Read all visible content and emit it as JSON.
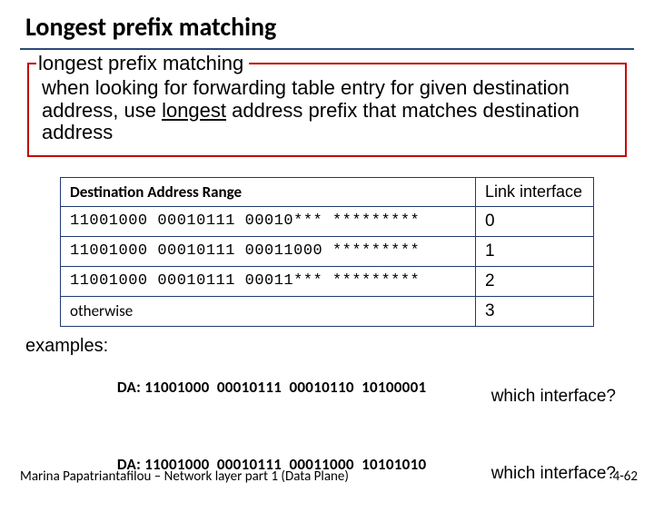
{
  "title": "Longest prefix matching",
  "defbox": {
    "legend": "longest prefix matching",
    "body_pre": "when looking for forwarding table entry for given destination address, use ",
    "body_underlined": "longest",
    "body_post": " address prefix that matches destination address"
  },
  "table": {
    "headers": {
      "range": "Destination Address Range",
      "link": "Link interface"
    },
    "rows": [
      {
        "range": "11001000 00010111 00010*** *********",
        "link": "0"
      },
      {
        "range": "11001000 00010111 00011000 *********",
        "link": "1"
      },
      {
        "range": "11001000 00010111 00011*** *********",
        "link": "2"
      },
      {
        "range": "otherwise",
        "link": "3"
      }
    ]
  },
  "examples": {
    "label": "examples:",
    "items": [
      {
        "da": "DA: 11001000  00010111  00010110  10100001",
        "q": "which interface?"
      },
      {
        "da": "DA: 11001000  00010111  00011000  10101010",
        "q": "which interface?"
      }
    ]
  },
  "footer": {
    "left": "Marina Papatriantafilou –  Network layer part 1 (Data Plane)",
    "right": "4-62"
  }
}
